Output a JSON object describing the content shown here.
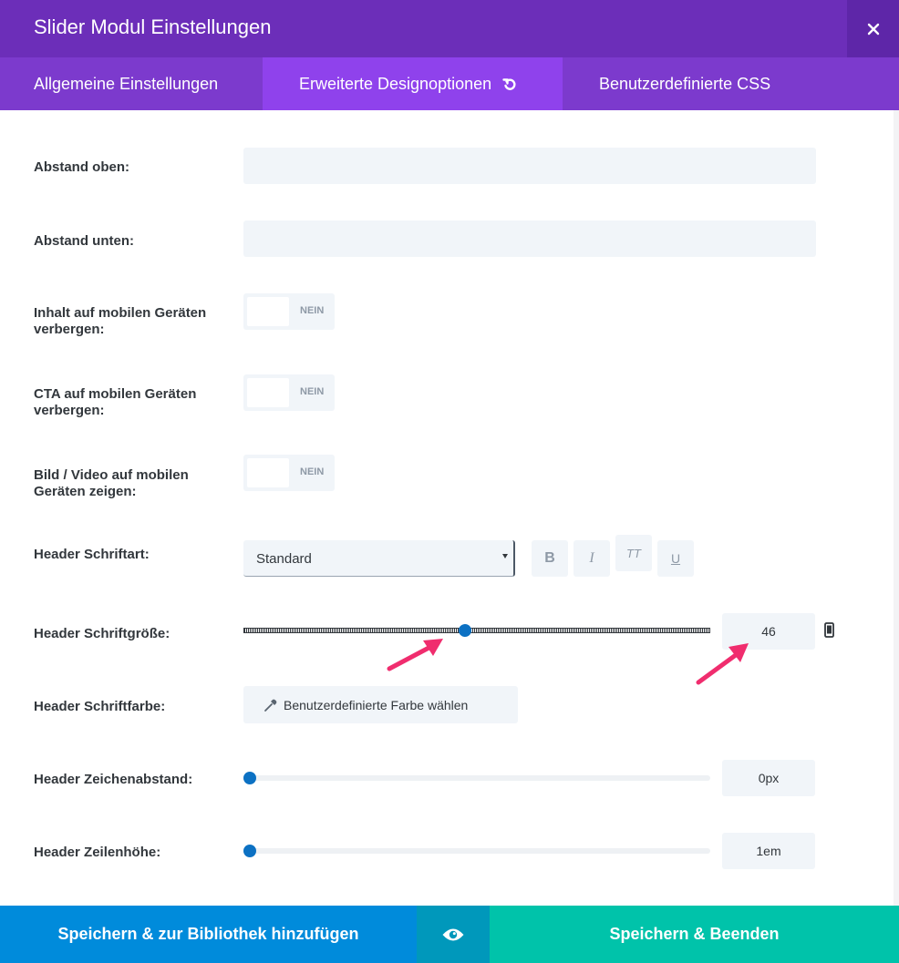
{
  "window": {
    "title": "Slider Modul Einstellungen"
  },
  "tabs": [
    {
      "label": "Allgemeine Einstellungen"
    },
    {
      "label": "Erweiterte Designoptionen",
      "active": true
    },
    {
      "label": "Benutzerdefinierte CSS"
    }
  ],
  "fields": {
    "abstand_oben": {
      "label": "Abstand oben:",
      "value": ""
    },
    "abstand_unten": {
      "label": "Abstand unten:",
      "value": ""
    },
    "inhalt_mobil": {
      "label": "Inhalt auf mobilen Geräten verbergen:",
      "state": "NEIN"
    },
    "cta_mobil": {
      "label": "CTA auf mobilen Geräten verbergen:",
      "state": "NEIN"
    },
    "bild_video_mobil": {
      "label": "Bild / Video auf mobilen Geräten zeigen:",
      "state": "NEIN"
    },
    "header_schriftart": {
      "label": "Header Schriftart:",
      "selected": "Standard",
      "style_buttons": {
        "bold": "B",
        "italic": "I",
        "caps": "TT",
        "underline": "U"
      }
    },
    "header_schriftgroesse": {
      "label": "Header Schriftgröße:",
      "value": "46",
      "slider_fraction": 0.46
    },
    "header_schriftfarbe": {
      "label": "Header Schriftfarbe:",
      "button": "Benutzerdefinierte Farbe wählen"
    },
    "header_zeichenabstand": {
      "label": "Header Zeichenabstand:",
      "value": "0px",
      "slider_fraction": 0.0
    },
    "header_zeilenhoehe": {
      "label": "Header Zeilenhöhe:",
      "value": "1em",
      "slider_fraction": 0.0
    }
  },
  "footer": {
    "library_button": "Speichern & zur Bibliothek hinzufügen",
    "save_button": "Speichern & Beenden"
  },
  "colors": {
    "titlebar": "#6c2eb9",
    "tabs": "#7c3acd",
    "active_tab": "#8f42ec",
    "slider_thumb": "#0c71c3",
    "library_button": "#008bdb",
    "preview_button": "#0098bb",
    "save_button": "#00c3aa",
    "annotation_arrow": "#f02d6e"
  },
  "icons": {
    "close": "close-icon",
    "reset": "reset-icon",
    "device": "mobile-device-icon",
    "dropper": "eyedropper-icon",
    "preview": "eye-icon"
  }
}
